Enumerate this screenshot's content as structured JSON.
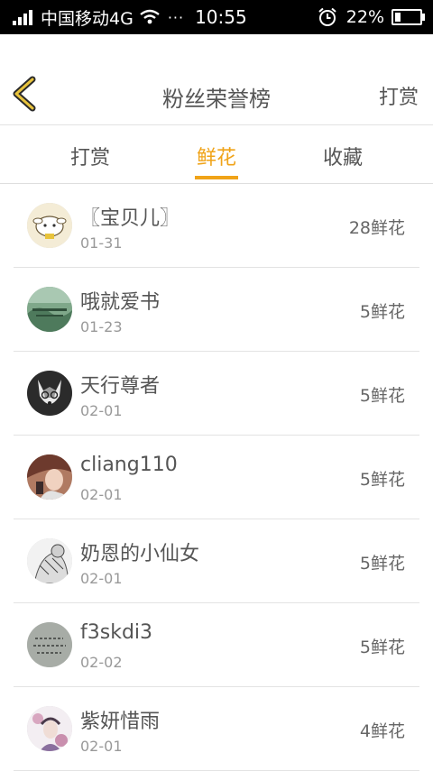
{
  "status": {
    "carrier": "中国移动4G",
    "dots": "···",
    "time": "10:55",
    "battery_pct": "22%",
    "battery_level": 0.22
  },
  "nav": {
    "title": "粉丝荣誉榜",
    "action_label": "打赏"
  },
  "tabs": [
    {
      "label": "打赏",
      "active": false
    },
    {
      "label": "鲜花",
      "active": true
    },
    {
      "label": "收藏",
      "active": false
    }
  ],
  "accent_color": "#f0a318",
  "rows": [
    {
      "name": "〖宝贝儿〗",
      "date": "01-31",
      "amount": "28鲜花",
      "avatar": "cartoon-sheep"
    },
    {
      "name": "哦就爱书",
      "date": "01-23",
      "amount": "5鲜花",
      "avatar": "green-forest"
    },
    {
      "name": "天行尊者",
      "date": "02-01",
      "amount": "5鲜花",
      "avatar": "husky-dog"
    },
    {
      "name": "cliang110",
      "date": "02-01",
      "amount": "5鲜花",
      "avatar": "girl-portrait"
    },
    {
      "name": "奶恩的小仙女",
      "date": "02-01",
      "amount": "5鲜花",
      "avatar": "sketch-person"
    },
    {
      "name": "f3skdi3",
      "date": "02-02",
      "amount": "5鲜花",
      "avatar": "handwriting-gray"
    },
    {
      "name": "紫妍惜雨",
      "date": "02-01",
      "amount": "4鲜花",
      "avatar": "floral-girl"
    }
  ]
}
